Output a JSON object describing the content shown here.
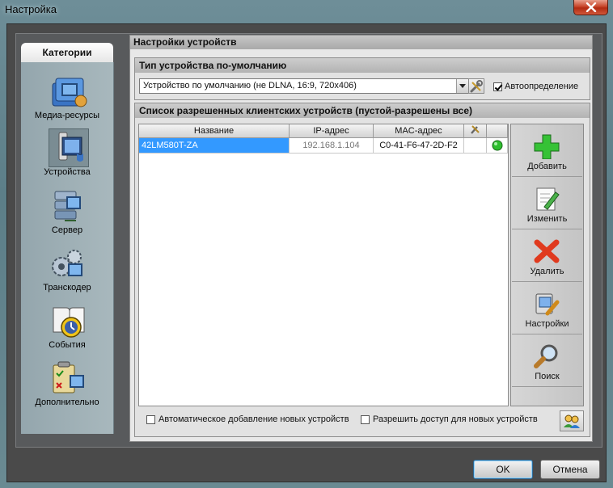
{
  "window": {
    "title": "Настройка",
    "close_icon": "close-icon"
  },
  "sidebar": {
    "header": "Категории",
    "items": [
      {
        "label": "Медиа-ресурсы",
        "icon": "media-resources-icon"
      },
      {
        "label": "Устройства",
        "icon": "devices-icon",
        "selected": true
      },
      {
        "label": "Сервер",
        "icon": "server-icon"
      },
      {
        "label": "Транскодер",
        "icon": "transcoder-icon"
      },
      {
        "label": "События",
        "icon": "events-icon"
      },
      {
        "label": "Дополнительно",
        "icon": "additional-icon"
      }
    ]
  },
  "panel": {
    "title": "Настройки устройств",
    "default_type": {
      "title": "Тип устройства по-умолчанию",
      "selected_value": "Устройство по умолчанию (не DLNA, 16:9, 720x406)",
      "autodetect_label": "Автоопределение",
      "autodetect_checked": true
    },
    "allowed_list": {
      "title": "Список разрешенных клиентских устройств (пустой-разрешены все)",
      "columns": [
        "Название",
        "IP-адрес",
        "MAC-адрес"
      ],
      "rows": [
        {
          "name": "42LM580T-ZA",
          "ip": "192.168.1.104",
          "mac": "C0-41-F6-47-2D-F2",
          "status": "online"
        }
      ],
      "buttons": [
        {
          "label": "Добавить",
          "icon": "add-icon"
        },
        {
          "label": "Изменить",
          "icon": "edit-icon"
        },
        {
          "label": "Удалить",
          "icon": "delete-icon"
        },
        {
          "label": "Настройки",
          "icon": "settings-icon"
        },
        {
          "label": "Поиск",
          "icon": "search-icon"
        }
      ],
      "auto_add_label": "Автоматическое добавление новых устройств",
      "allow_new_label": "Разрешить доступ для новых устройств"
    }
  },
  "dialog": {
    "ok_label": "OK",
    "cancel_label": "Отмена"
  },
  "colors": {
    "selection": "#3399ff",
    "status_online": "#2fbf2f"
  }
}
